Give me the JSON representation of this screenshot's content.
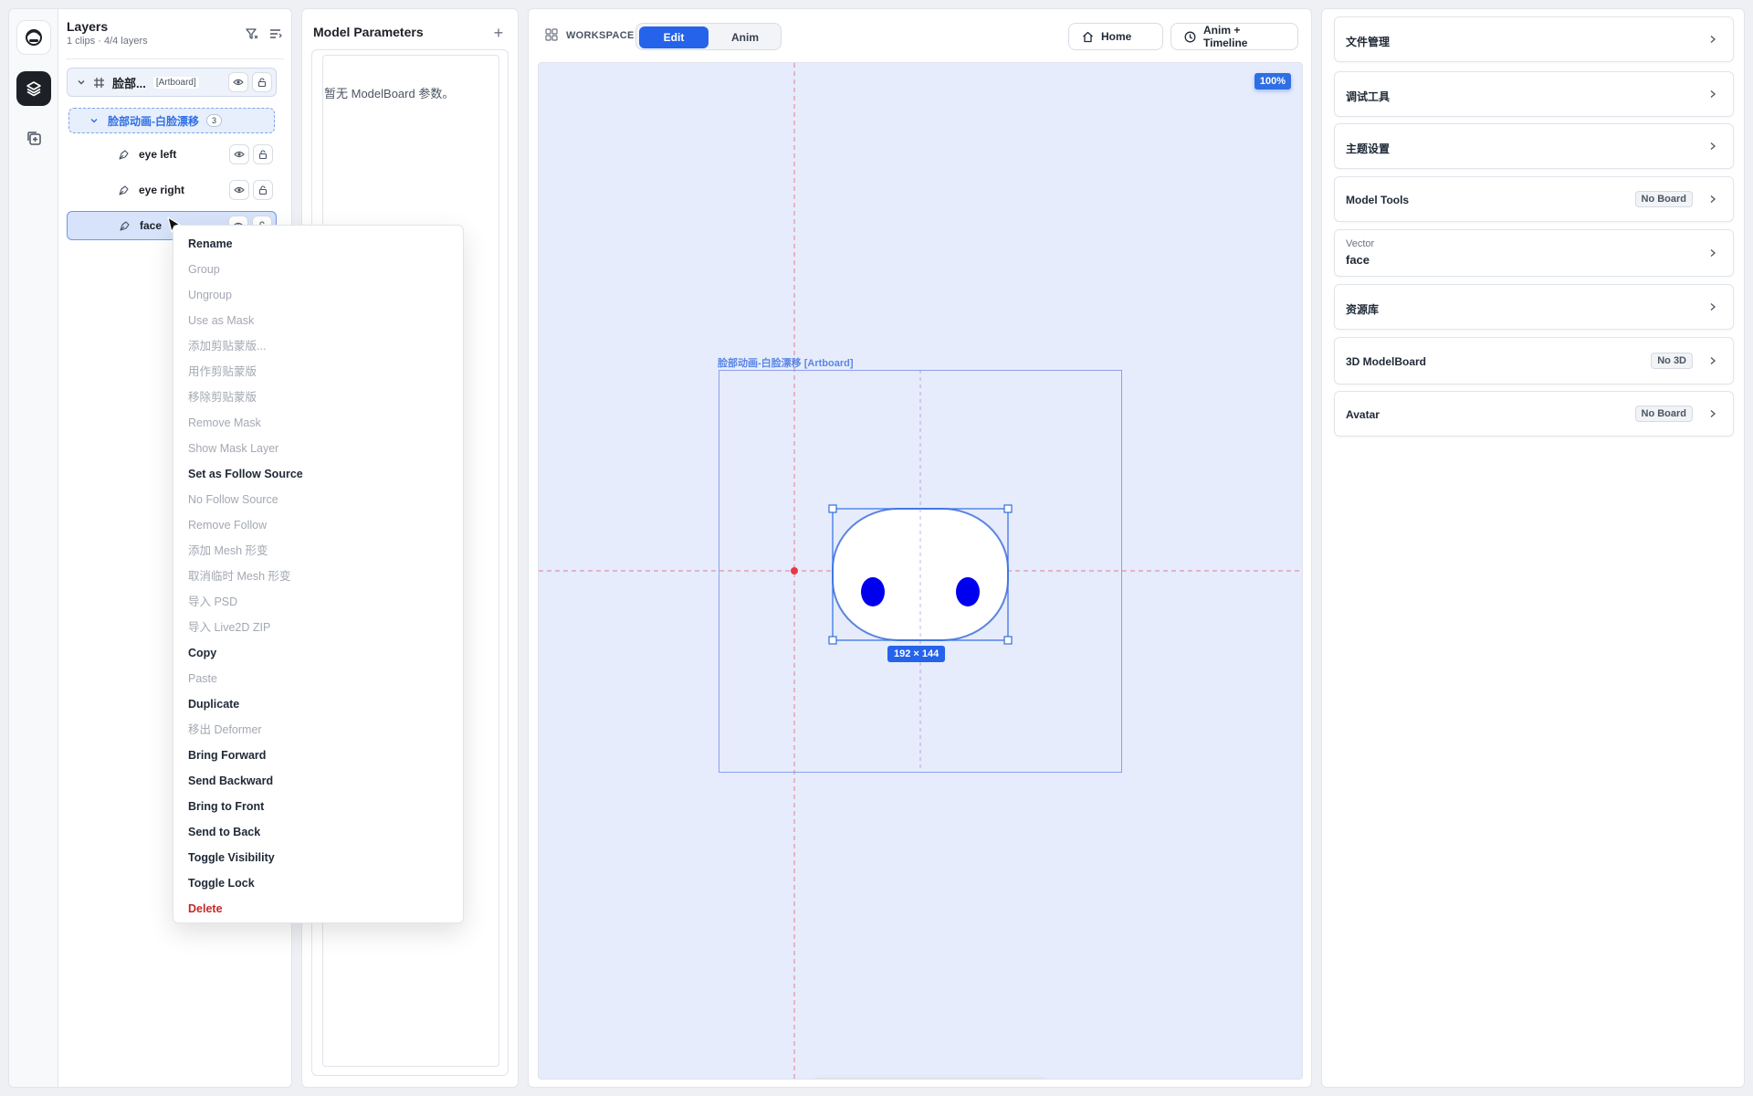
{
  "layers_panel": {
    "title": "Layers",
    "subtitle": "1 clips · 4/4 layers",
    "artboard_row": {
      "name": "脸部...",
      "tag": "[Artboard]"
    },
    "group_row": {
      "name": "脸部动画-白脸漂移",
      "count": "3"
    },
    "rows": [
      {
        "name": "eye left"
      },
      {
        "name": "eye right"
      },
      {
        "name": "face"
      }
    ]
  },
  "params_panel": {
    "title": "Model Parameters",
    "add_icon": "+",
    "empty_text": "暂无 ModelBoard 参数。"
  },
  "workspace": {
    "label": "WORKSPACE",
    "mode_tabs": [
      "Edit",
      "Anim"
    ],
    "active_mode": "Edit",
    "home_label": "Home",
    "anim_timeline_label": "Anim + Timeline",
    "zoom": "100%",
    "artboard_label": "脸部动画-白脸漂移 [Artboard]",
    "selection_size": "192 × 144",
    "accent_color": "#2563eb",
    "eye_color": "#0000ee"
  },
  "context_menu": {
    "items": [
      {
        "label": "Rename",
        "state": "on"
      },
      {
        "label": "Group",
        "state": "off"
      },
      {
        "label": "Ungroup",
        "state": "off"
      },
      {
        "label": "Use as Mask",
        "state": "off"
      },
      {
        "label": "添加剪贴蒙版...",
        "state": "off"
      },
      {
        "label": "用作剪贴蒙版",
        "state": "off"
      },
      {
        "label": "移除剪贴蒙版",
        "state": "off"
      },
      {
        "label": "Remove Mask",
        "state": "off"
      },
      {
        "label": "Show Mask Layer",
        "state": "off"
      },
      {
        "label": "Set as Follow Source",
        "state": "on"
      },
      {
        "label": "No Follow Source",
        "state": "off"
      },
      {
        "label": "Remove Follow",
        "state": "off"
      },
      {
        "label": "添加 Mesh 形变",
        "state": "off"
      },
      {
        "label": "取消临时 Mesh 形变",
        "state": "off"
      },
      {
        "label": "导入 PSD",
        "state": "off"
      },
      {
        "label": "导入 Live2D ZIP",
        "state": "off"
      },
      {
        "label": "Copy",
        "state": "on"
      },
      {
        "label": "Paste",
        "state": "off"
      },
      {
        "label": "Duplicate",
        "state": "on"
      },
      {
        "label": "移出 Deformer",
        "state": "off"
      },
      {
        "label": "Bring Forward",
        "state": "on"
      },
      {
        "label": "Send Backward",
        "state": "on"
      },
      {
        "label": "Bring to Front",
        "state": "on"
      },
      {
        "label": "Send to Back",
        "state": "on"
      },
      {
        "label": "Toggle Visibility",
        "state": "on"
      },
      {
        "label": "Toggle Lock",
        "state": "on"
      },
      {
        "label": "Delete",
        "state": "danger"
      }
    ]
  },
  "right_panel": {
    "cards": [
      {
        "title": "文件管理",
        "badge": ""
      },
      {
        "title": "调试工具",
        "badge": ""
      },
      {
        "title": "主题设置",
        "badge": ""
      },
      {
        "title": "Model Tools",
        "badge": "No Board"
      },
      {
        "title": "face",
        "subtitle": "Vector",
        "badge": ""
      },
      {
        "title": "资源库",
        "badge": ""
      },
      {
        "title": "3D ModelBoard",
        "badge": "No 3D"
      },
      {
        "title": "Avatar",
        "badge": "No Board"
      }
    ]
  }
}
